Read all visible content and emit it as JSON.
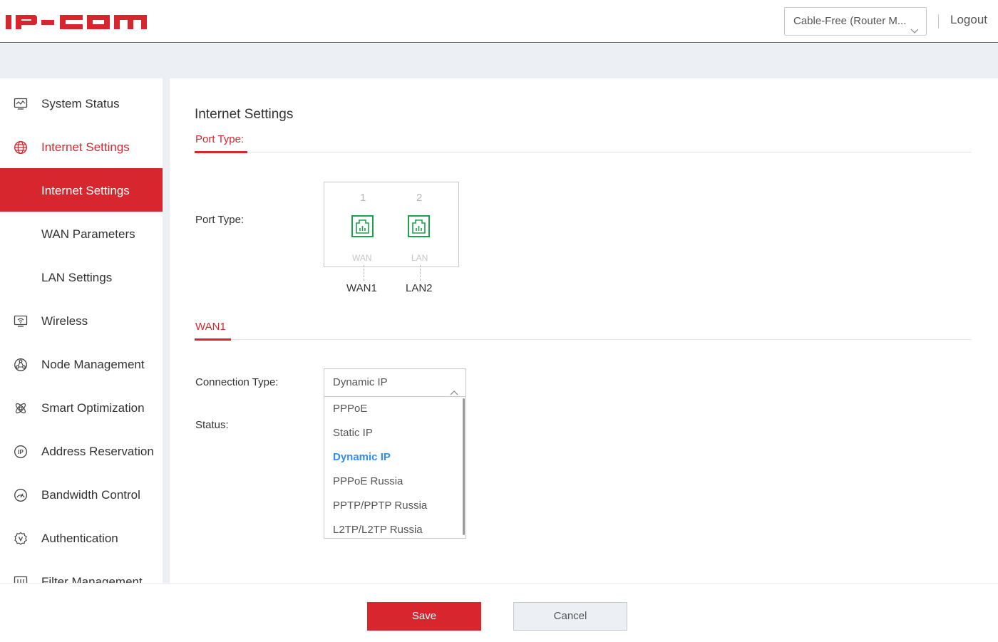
{
  "header": {
    "logo_text": "IP-COM",
    "mode_select": "Cable-Free (Router M...",
    "logout": "Logout"
  },
  "sidebar": {
    "items": [
      {
        "label": "System Status",
        "icon": "monitor-icon"
      },
      {
        "label": "Internet Settings",
        "icon": "globe-icon",
        "state": "expanded"
      },
      {
        "label": "Internet Settings",
        "icon": "",
        "state": "active"
      },
      {
        "label": "WAN Parameters",
        "icon": ""
      },
      {
        "label": "LAN Settings",
        "icon": ""
      },
      {
        "label": "Wireless",
        "icon": "wifi-icon"
      },
      {
        "label": "Node Management",
        "icon": "node-icon"
      },
      {
        "label": "Smart Optimization",
        "icon": "atom-icon"
      },
      {
        "label": "Address Reservation",
        "icon": "ip-icon"
      },
      {
        "label": "Bandwidth Control",
        "icon": "gauge-icon"
      },
      {
        "label": "Authentication",
        "icon": "shield-v-icon"
      },
      {
        "label": "Filter Management",
        "icon": "filter-icon"
      }
    ]
  },
  "main": {
    "title": "Internet Settings",
    "port_section_tab": "Port Type:",
    "port_type_label": "Port Type:",
    "ports": [
      {
        "number": "1",
        "type": "WAN",
        "name": "WAN1"
      },
      {
        "number": "2",
        "type": "LAN",
        "name": "LAN2"
      }
    ],
    "wan_section_tab": "WAN1",
    "connection_type_label": "Connection Type:",
    "connection_type_value": "Dynamic IP",
    "status_label": "Status:",
    "connection_options": [
      "PPPoE",
      "Static IP",
      "Dynamic IP",
      "PPPoE Russia",
      "PPTP/PPTP Russia",
      "L2TP/L2TP Russia"
    ],
    "selected_option": "Dynamic IP"
  },
  "footer": {
    "save": "Save",
    "cancel": "Cancel"
  },
  "colors": {
    "brand_red": "#d7262e",
    "port_green": "#1aa34a",
    "selected_blue": "#2f8ef0",
    "band_grey": "#eceff3"
  }
}
